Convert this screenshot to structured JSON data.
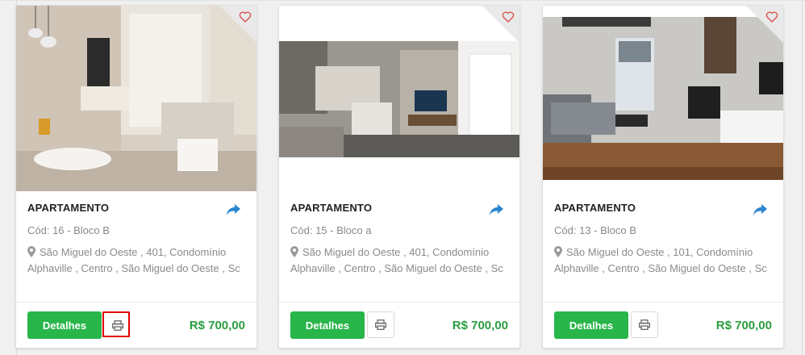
{
  "colors": {
    "details_button": "#28b54a",
    "price": "#2a9d3f",
    "share_icon": "#2a86d1",
    "heart": "#d9534f",
    "highlight": "#e00000"
  },
  "cards": [
    {
      "type": "APARTAMENTO",
      "code": "Cód: 16 - Bloco B",
      "address": "São Miguel do Oeste , 401, Condomínio Alphaville , Centro , São Miguel do Oeste , Sc",
      "details_label": "Detalhes",
      "price": "R$ 700,00",
      "image": "living-room-photo"
    },
    {
      "type": "APARTAMENTO",
      "code": "Cód: 15 - Bloco a",
      "address": "São Miguel do Oeste , 401, Condomínio Alphaville , Centro , São Miguel do Oeste , Sc",
      "details_label": "Detalhes",
      "price": "R$ 700,00",
      "image": "kitchen-living-render"
    },
    {
      "type": "APARTAMENTO",
      "code": "Cód: 13 - Bloco B",
      "address": "São Miguel do Oeste , 101, Condomínio Alphaville , Centro , São Miguel do Oeste , Sc",
      "details_label": "Detalhes",
      "price": "R$ 700,00",
      "image": "modern-living-room-photo"
    }
  ],
  "icons": {
    "favorite": "heart-outline-icon",
    "share": "share-arrow-icon",
    "print": "printer-icon",
    "location": "map-marker-icon"
  }
}
